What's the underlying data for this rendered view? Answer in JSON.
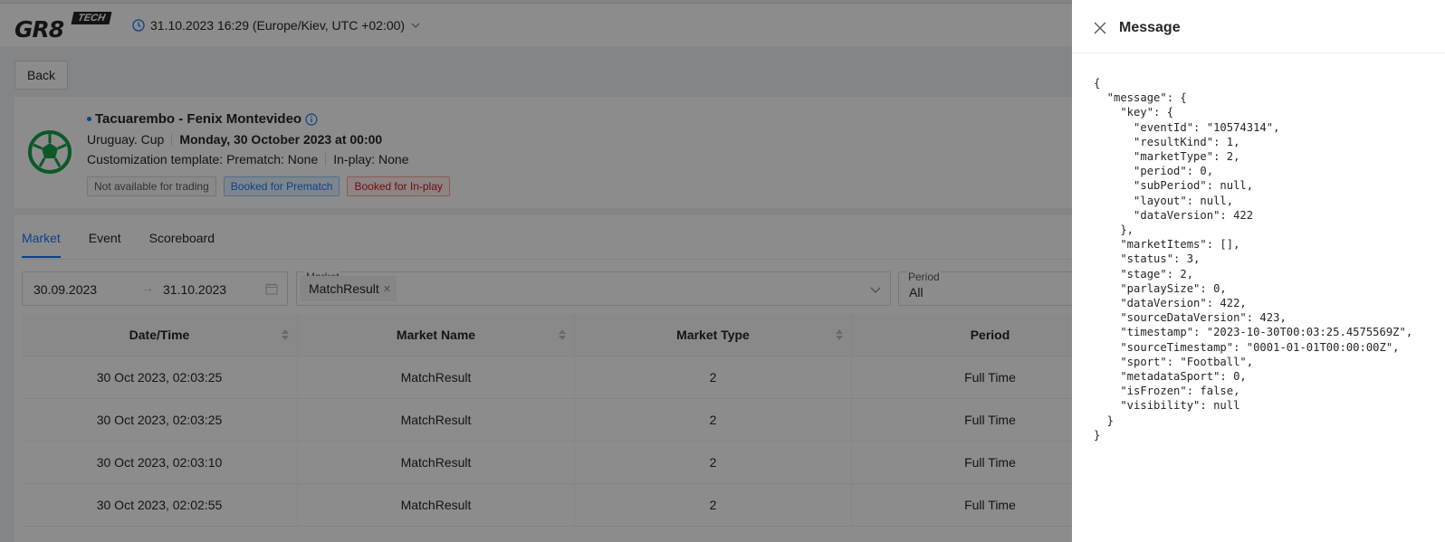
{
  "header": {
    "logo_text": "GR8",
    "logo_badge": "TECH",
    "datetime": "31.10.2023 16:29 (Europe/Kiev, UTC +02:00)"
  },
  "back_label": "Back",
  "event": {
    "title": "Tacuarembo - Fenix Montevideo",
    "league": "Uruguay. Cup",
    "date": "Monday, 30 October 2023 at 00:00",
    "template": "Customization template: Prematch: None",
    "inplay": "In-play: None",
    "badges": {
      "trading": "Not available for trading",
      "prematch": "Booked for Prematch",
      "inplay": "Booked for In-play"
    }
  },
  "tabs": [
    "Market",
    "Event",
    "Scoreboard"
  ],
  "filters": {
    "date_from": "30.09.2023",
    "date_to": "31.10.2023",
    "market_label": "Market",
    "market_tag": "MatchResult",
    "period_label": "Period",
    "period_value": "All"
  },
  "table": {
    "columns": [
      "Date/Time",
      "Market Name",
      "Market Type",
      "Period",
      ""
    ],
    "rows": [
      [
        "30 Oct 2023, 02:03:25",
        "MatchResult",
        "2",
        "Full Time"
      ],
      [
        "30 Oct 2023, 02:03:25",
        "MatchResult",
        "2",
        "Full Time"
      ],
      [
        "30 Oct 2023, 02:03:10",
        "MatchResult",
        "2",
        "Full Time"
      ],
      [
        "30 Oct 2023, 02:02:55",
        "MatchResult",
        "2",
        "Full Time"
      ]
    ]
  },
  "drawer": {
    "title": "Message",
    "json": "{\n  \"message\": {\n    \"key\": {\n      \"eventId\": \"10574314\",\n      \"resultKind\": 1,\n      \"marketType\": 2,\n      \"period\": 0,\n      \"subPeriod\": null,\n      \"layout\": null,\n      \"dataVersion\": 422\n    },\n    \"marketItems\": [],\n    \"status\": 3,\n    \"stage\": 2,\n    \"parlaySize\": 0,\n    \"dataVersion\": 422,\n    \"sourceDataVersion\": 423,\n    \"timestamp\": \"2023-10-30T00:03:25.4575569Z\",\n    \"sourceTimestamp\": \"0001-01-01T00:00:00Z\",\n    \"sport\": \"Football\",\n    \"metadataSport\": 0,\n    \"isFrozen\": false,\n    \"visibility\": null\n  }\n}"
  },
  "colors": {
    "accent": "#1677ff",
    "mask": "rgba(0,0,0,0.45)"
  }
}
